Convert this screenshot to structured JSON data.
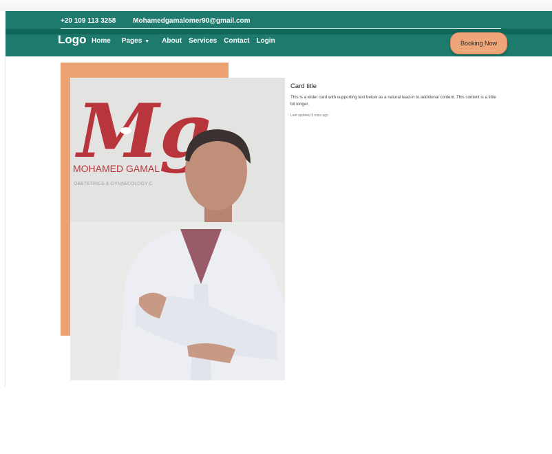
{
  "header": {
    "phone": "+20 109 113 3258",
    "email": "Mohamedgamalomer90@gmail.com",
    "logo": "Logo",
    "nav": [
      "Home",
      "Pages",
      "About",
      "Services",
      "Contact",
      "Login"
    ],
    "booking_label": "Booking Now"
  },
  "card": {
    "title": "Card title",
    "text": "This is a wider card with supporting text below as a natural lead-in to additional content. This content is a little bit longer.",
    "updated": "Last updated 3 mins ago"
  },
  "photo": {
    "sign_letters": "Mg",
    "sign_name": "MOHAMED GAMAL",
    "sign_sub": "OBSTETRICS & GYNAECOLOGY C"
  },
  "colors": {
    "header_bg": "#1e7a6c",
    "accent": "#eea57a",
    "deco": "#eba172"
  },
  "icons": [
    "caret-down-icon"
  ]
}
